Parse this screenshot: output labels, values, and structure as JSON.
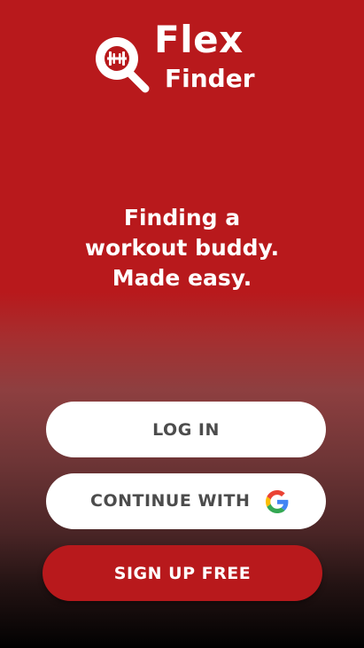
{
  "app": {
    "logo": {
      "line1": "Flex",
      "line2": "Finder"
    },
    "tagline": {
      "line1": "Finding a",
      "line2": "workout buddy.",
      "line3": "Made easy."
    }
  },
  "actions": {
    "login_label": "LOG IN",
    "google_label": "CONTINUE WITH",
    "google_icon": "google-g-icon",
    "signup_label": "SIGN UP FREE"
  },
  "colors": {
    "brand_red": "#b8191c",
    "button_text_dark": "#4c4c4c",
    "white": "#ffffff"
  }
}
